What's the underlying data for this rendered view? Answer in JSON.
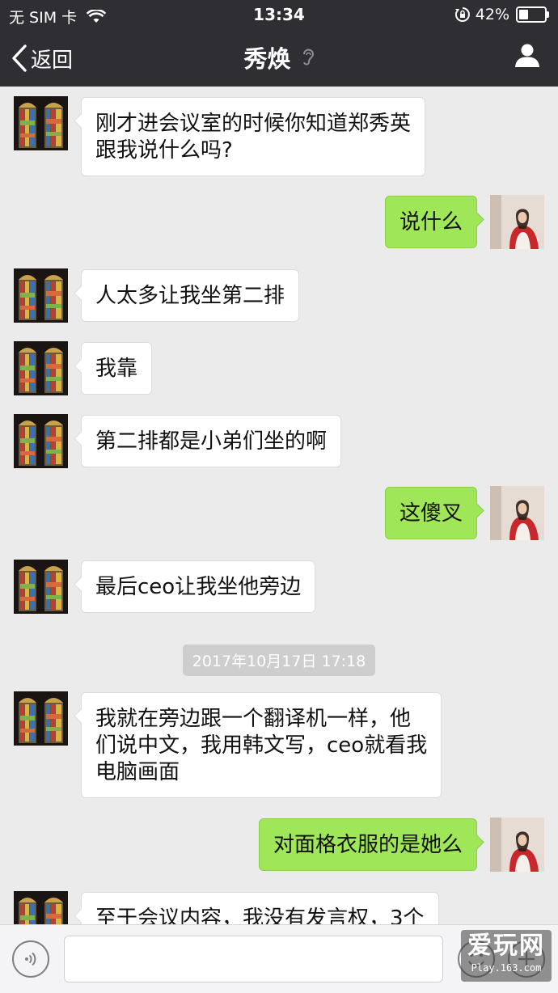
{
  "status_bar": {
    "carrier": "无 SIM 卡",
    "time": "13:34",
    "battery_percent_text": "42%",
    "battery_level": 0.42,
    "icons": [
      "wifi-icon",
      "rotation-lock-icon",
      "battery-icon"
    ]
  },
  "nav": {
    "back_label": "返回",
    "title": "秀焕",
    "icons": [
      "chevron-left-icon",
      "earpiece-mode-icon",
      "profile-icon"
    ]
  },
  "messages": [
    {
      "side": "left",
      "avatar": "stained-glass-avatar",
      "text": "刚才进会议室的时候你知道郑秀英\n跟我说什么吗?"
    },
    {
      "side": "right",
      "avatar": "woman-avatar",
      "text": "说什么"
    },
    {
      "side": "left",
      "avatar": "stained-glass-avatar",
      "text": "人太多让我坐第二排"
    },
    {
      "side": "left",
      "avatar": "stained-glass-avatar",
      "text": "我靠"
    },
    {
      "side": "left",
      "avatar": "stained-glass-avatar",
      "text": "第二排都是小弟们坐的啊"
    },
    {
      "side": "right",
      "avatar": "woman-avatar",
      "text": "这傻叉"
    },
    {
      "side": "left",
      "avatar": "stained-glass-avatar",
      "text": "最后ceo让我坐他旁边"
    },
    {
      "side": "left",
      "avatar": "stained-glass-avatar",
      "text": "我就在旁边跟一个翻译机一样，他\n们说中文，我用韩文写，ceo就看我\n电脑画面"
    },
    {
      "side": "right",
      "avatar": "woman-avatar",
      "text": "对面格衣服的是她么"
    },
    {
      "side": "left",
      "avatar": "stained-glass-avatar",
      "text": "至于会议内容，我没有发言权，3个"
    }
  ],
  "timestamp": "2017年10月17日 17:18",
  "input_bar": {
    "placeholder": "",
    "icons": [
      "voice-icon",
      "emoji-icon",
      "plus-icon"
    ]
  },
  "watermark": {
    "main": "爱玩网",
    "sub": "Play.163.com"
  },
  "colors": {
    "nav_bg": "#2e2e33",
    "chat_bg": "#ebebeb",
    "bubble_sent": "#9fe658",
    "bubble_received": "#ffffff",
    "timestamp_bg": "#cecece"
  }
}
